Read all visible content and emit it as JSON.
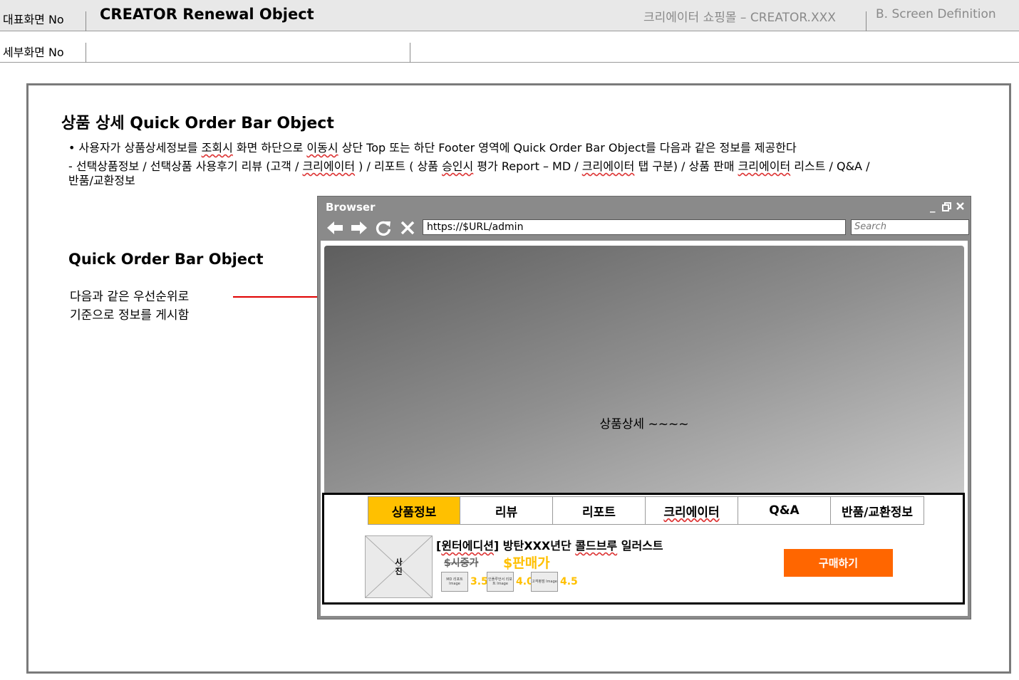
{
  "header": {
    "main_screen_label": "대표화면 No",
    "sub_screen_label": "세부화면 No",
    "title": "CREATOR Renewal Object",
    "site": "크리에이터 쇼핑몰 – CREATOR.XXX",
    "doc_section": "B. Screen Definition"
  },
  "section": {
    "title": "상품 상세 Quick Order Bar Object",
    "bullet1_parts": [
      "• 사용자가 상품상세정보를 ",
      "조회시",
      " 화면 하단으로 ",
      "이동시",
      " 상단 Top 또는 하단 Footer 영역에 Quick Order Bar Object를 다음과 같은 정보를 제공한다"
    ],
    "bullet2_parts": [
      "- 선택상품정보 / 선택상품 사용후기 리뷰 (고객 / ",
      "크리에이터",
      " ) / 리포트 ( 상품 ",
      "승인시",
      " 평가 Report – MD / ",
      "크리에이터",
      " 탭 구분) / 상품 판매 ",
      "크리에이터",
      " 리스트 / Q&A /"
    ],
    "bullet2_line2": "반품/교환정보"
  },
  "side": {
    "title": "Quick Order Bar Object",
    "line1": "다음과 같은 우선순위로",
    "line2": "기준으로 정보를 게시함"
  },
  "browser": {
    "title": "Browser",
    "url": "https://$URL/admin",
    "search_placeholder": "Search",
    "hero_text": "상품상세 ~~~~"
  },
  "quick_order_bar": {
    "tabs": [
      "상품정보",
      "리뷰",
      "리포트",
      "크리에이터",
      "Q&A",
      "반품/교환정보"
    ],
    "active_tab": "상품정보",
    "photo_label_line1": "사",
    "photo_label_line2": "진",
    "product_name_parts": [
      "[",
      "윈터에디션",
      "] 방탄XXX년단 ",
      "콜드브루",
      " 일러스트"
    ],
    "list_price": "$시중가",
    "sale_price": "$판매가",
    "ratings": [
      {
        "image_label": "MD 리포트 Image",
        "score": "3.5"
      },
      {
        "image_label": "인플루언서 리포트 Image",
        "score": "4.0"
      },
      {
        "image_label": "고객평점 Image",
        "score": "4.5"
      }
    ],
    "buy_button": "구매하기"
  },
  "colors": {
    "accent_yellow": "#ffc000",
    "buy_orange": "#ff6600",
    "connector_red": "#e00000"
  }
}
